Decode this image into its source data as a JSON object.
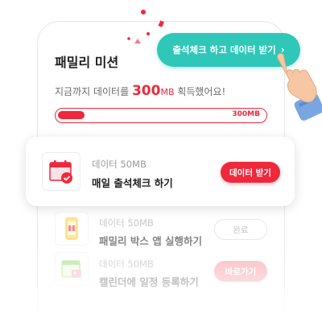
{
  "header": {
    "title": "패밀리 미션"
  },
  "summary": {
    "prefix": "지금까지 데이터를 ",
    "amount": "300",
    "unit": "MB",
    "suffix": " 획득했어요!"
  },
  "progress": {
    "label": "300MB",
    "fill_ratio": 0.13
  },
  "cta": {
    "label": "출석체크 하고 데이터 받기",
    "chevron": "›"
  },
  "missions": [
    {
      "reward": "데이터 50MB",
      "title": "매일 출석체크 하기",
      "button": "데이터 받기",
      "icon": "calendar-check-icon"
    },
    {
      "reward": "데이터 50MB",
      "title": "패밀리 박스 앱 실행하기",
      "button": "완료",
      "icon": "phone-gift-icon"
    },
    {
      "reward": "데이터 50MB",
      "title": "캘린더에 일정 등록하기",
      "button": "바로가기",
      "icon": "calendar-event-icon"
    }
  ],
  "colors": {
    "accent": "#f0283b",
    "cta": "#2fc7b8",
    "go_button": "#f57d89"
  }
}
